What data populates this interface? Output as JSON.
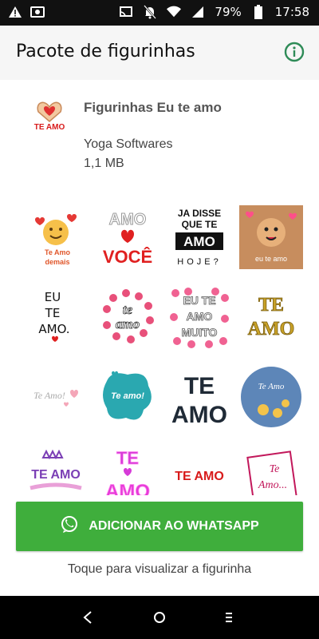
{
  "status_bar": {
    "battery": "79%",
    "time": "17:58"
  },
  "appbar": {
    "title": "Pacote de figurinhas"
  },
  "pack": {
    "name": "Figurinhas Eu te amo",
    "publisher": "Yoga Softwares",
    "size": "1,1 MB",
    "icon_text": "TE AMO"
  },
  "stickers": [
    {
      "lines": [
        "Te Amo",
        "demais"
      ]
    },
    {
      "lines": [
        "AMO",
        "VOCÊ"
      ]
    },
    {
      "lines": [
        "JA DISSE",
        "QUE TE",
        "AMO",
        "HOJE?"
      ]
    },
    {
      "lines": [
        "eu te amo"
      ]
    },
    {
      "lines": [
        "EU",
        "TE",
        "AMO."
      ]
    },
    {
      "lines": [
        "te",
        "amo"
      ]
    },
    {
      "lines": [
        "EU TE",
        "AMO",
        "MUITO"
      ]
    },
    {
      "lines": [
        "TE",
        "AMO"
      ]
    },
    {
      "lines": [
        "Te Amo!"
      ]
    },
    {
      "lines": [
        "Te amo!"
      ]
    },
    {
      "lines": [
        "TE",
        "AMO"
      ]
    },
    {
      "lines": [
        "Te Amo"
      ]
    },
    {
      "lines": [
        "TE AMO"
      ]
    },
    {
      "lines": [
        "TE",
        "AMO"
      ]
    },
    {
      "lines": [
        "TE AMO"
      ]
    },
    {
      "lines": [
        "Te",
        "Amo..."
      ]
    }
  ],
  "actions": {
    "add_button": "ADICIONAR AO WHATSAPP",
    "hint": "Toque para visualizar a figurinha"
  },
  "colors": {
    "primary_green": "#3fae3c",
    "info_green": "#2e8b57"
  }
}
